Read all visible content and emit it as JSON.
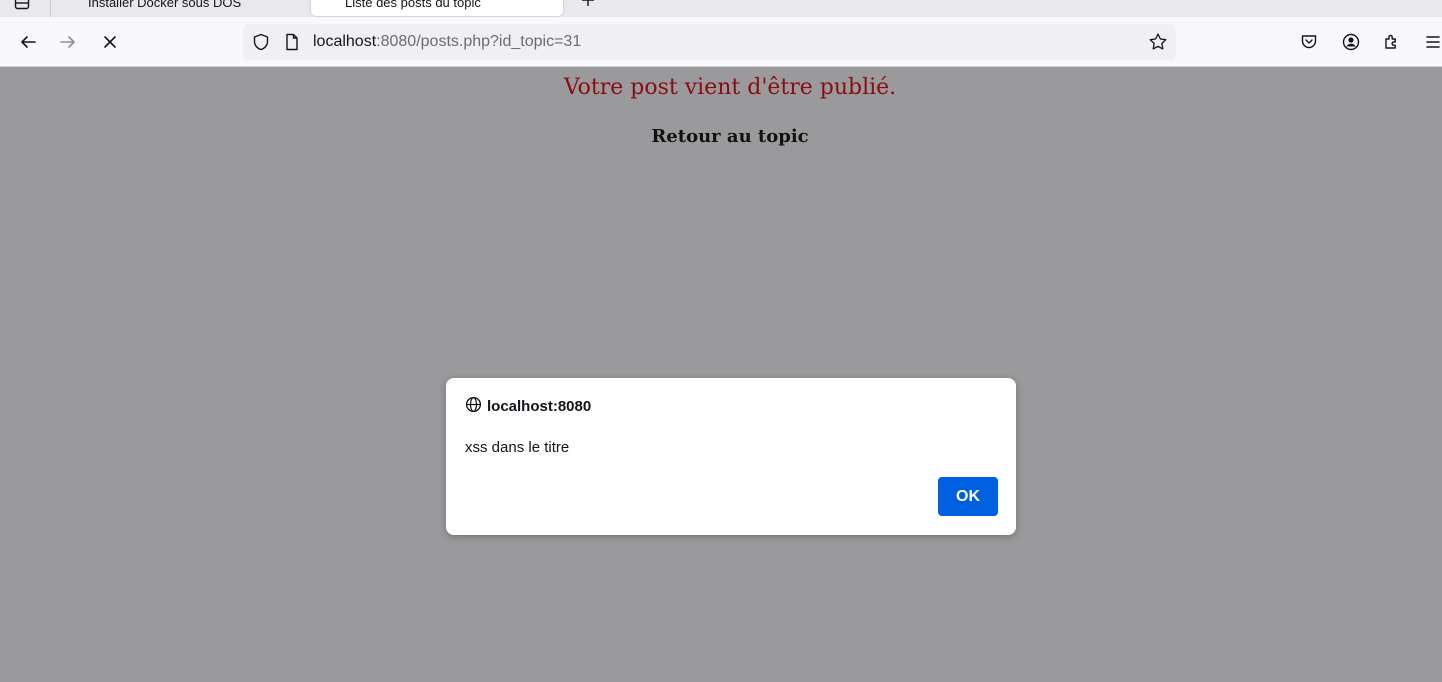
{
  "tabs": [
    {
      "title": "Installer Docker sous DOS",
      "active": false
    },
    {
      "title": "Liste des posts du topic",
      "active": true
    }
  ],
  "urlbar": {
    "host": "localhost",
    "rest": ":8080/posts.php?id_topic=31"
  },
  "page": {
    "message": "Votre post vient d'être publié.",
    "back_link": "Retour au topic"
  },
  "dialog": {
    "origin": "localhost:8080",
    "text": "xss dans le titre",
    "ok_label": "OK"
  },
  "colors": {
    "message": "#8b0c10",
    "ok_button": "#0061e0",
    "overlay_background": "#9a9a9c"
  }
}
